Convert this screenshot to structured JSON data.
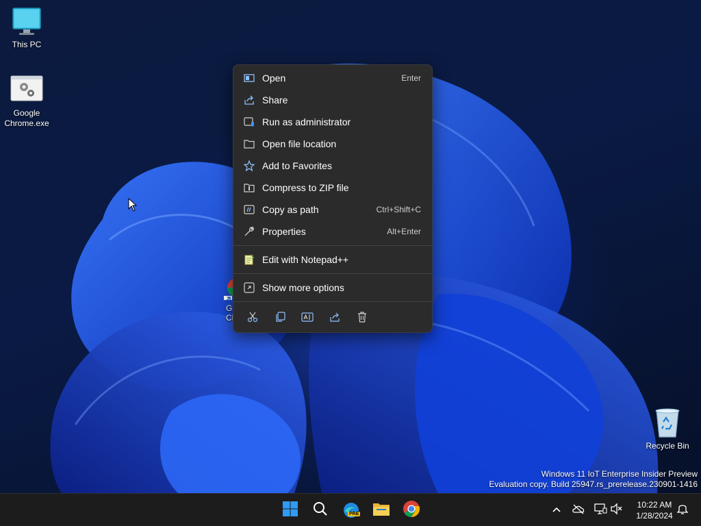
{
  "desktop": {
    "icons": [
      {
        "label": "This PC",
        "icon": "monitor-icon"
      },
      {
        "label": "Google Chrome.exe",
        "icon": "exe-file-icon"
      },
      {
        "label": "Recycle Bin",
        "icon": "recycle-bin-icon"
      }
    ],
    "partial_shortcut_label": [
      "G",
      "Cl"
    ],
    "watermark": {
      "line1": "Windows 11 IoT Enterprise Insider Preview",
      "line2": "Evaluation copy. Build 25947.rs_prerelease.230901-1416"
    }
  },
  "context_menu": {
    "items": [
      {
        "label": "Open",
        "shortcut": "Enter",
        "icon": "open-icon"
      },
      {
        "label": "Share",
        "shortcut": "",
        "icon": "share-icon"
      },
      {
        "label": "Run as administrator",
        "shortcut": "",
        "icon": "shield-icon"
      },
      {
        "label": "Open file location",
        "shortcut": "",
        "icon": "folder-icon"
      },
      {
        "label": "Add to Favorites",
        "shortcut": "",
        "icon": "star-icon"
      },
      {
        "label": "Compress to ZIP file",
        "shortcut": "",
        "icon": "zip-icon"
      },
      {
        "label": "Copy as path",
        "shortcut": "Ctrl+Shift+C",
        "icon": "path-icon"
      },
      {
        "label": "Properties",
        "shortcut": "Alt+Enter",
        "icon": "wrench-icon"
      }
    ],
    "notepad_item": {
      "label": "Edit with Notepad++",
      "icon": "notepad-plus-icon"
    },
    "more_item": {
      "label": "Show more options",
      "icon": "more-options-icon"
    },
    "quick_actions": [
      "cut-icon",
      "copy-icon",
      "rename-icon",
      "share-icon",
      "delete-icon"
    ]
  },
  "taskbar": {
    "apps": [
      "start-icon",
      "search-icon",
      "edge-pre-icon",
      "file-explorer-icon",
      "chrome-icon"
    ],
    "edge_badge": "PRE",
    "tray": [
      "chevron-up-icon",
      "onedrive-offline-icon",
      "network-icon",
      "speaker-muted-icon"
    ],
    "time": "10:22 AM",
    "date": "1/28/2024",
    "notification_icon": "bell-icon"
  },
  "colors": {
    "menu_bg": "#2b2b2b",
    "taskbar_bg": "#1c1c1c",
    "accent_blue": "#2f7ff0",
    "wallpaper_bloom": "#1a4dff"
  }
}
